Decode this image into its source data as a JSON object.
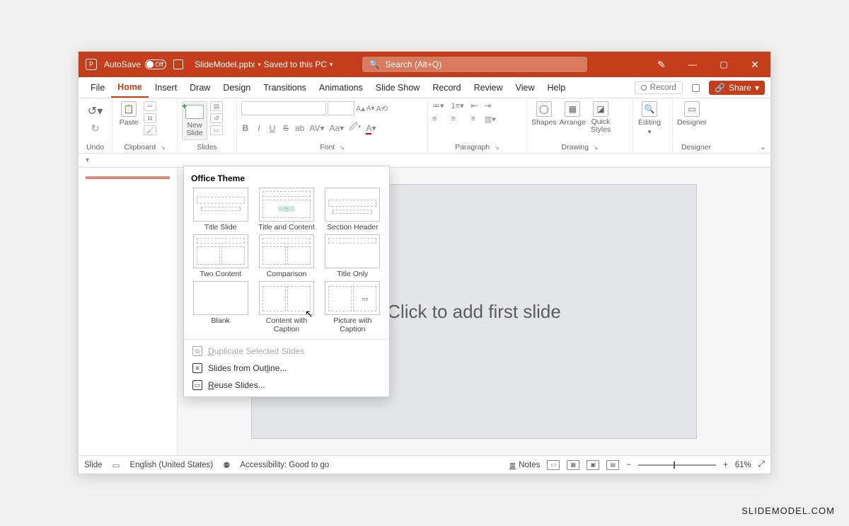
{
  "titlebar": {
    "autosave_label": "AutoSave",
    "autosave_state": "Off",
    "filename": "SlideModel.pptx",
    "save_status": "Saved to this PC",
    "search_placeholder": "Search (Alt+Q)"
  },
  "menu": {
    "items": [
      "File",
      "Home",
      "Insert",
      "Draw",
      "Design",
      "Transitions",
      "Animations",
      "Slide Show",
      "Record",
      "Review",
      "View",
      "Help"
    ],
    "active_index": 1,
    "record_btn": "Record",
    "share_btn": "Share"
  },
  "ribbon": {
    "undo_group": "Undo",
    "clipboard_group": "Clipboard",
    "paste_label": "Paste",
    "slides_group": "Slides",
    "new_slide_label": "New\nSlide",
    "font_group": "Font",
    "paragraph_group": "Paragraph",
    "drawing_group": "Drawing",
    "shapes_label": "Shapes",
    "arrange_label": "Arrange",
    "quick_styles_label": "Quick\nStyles",
    "editing_label": "Editing",
    "designer_group": "Designer",
    "designer_label": "Designer"
  },
  "dropdown": {
    "header": "Office Theme",
    "layouts": [
      "Title Slide",
      "Title and Content",
      "Section Header",
      "Two Content",
      "Comparison",
      "Title Only",
      "Blank",
      "Content with Caption",
      "Picture with Caption"
    ],
    "duplicate": "Duplicate Selected Slides",
    "from_outline": "Slides from Outline...",
    "reuse": "Reuse Slides..."
  },
  "canvas": {
    "placeholder": "Click to add first slide"
  },
  "statusbar": {
    "slide": "Slide",
    "language": "English (United States)",
    "accessibility": "Accessibility: Good to go",
    "notes": "Notes",
    "zoom": "61%"
  },
  "watermark": "SLIDEMODEL.COM"
}
